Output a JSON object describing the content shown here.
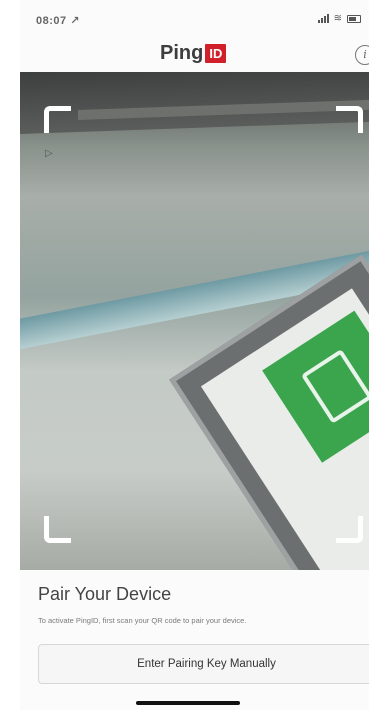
{
  "status_bar": {
    "time": "08:07",
    "time_suffix": "↗"
  },
  "header": {
    "logo_text": "Ping",
    "logo_badge": "ID",
    "info_glyph": "i"
  },
  "camera": {
    "cursor_glyph": "▷"
  },
  "pairing": {
    "title": "Pair Your Device",
    "description": "To activate PingID, first scan your QR code to pair your device.",
    "manual_button_label": "Enter Pairing Key Manually"
  },
  "colors": {
    "brand_red": "#d0202a",
    "scanner_green": "#3aa54d"
  },
  "icons": [
    "info-icon",
    "signal-icon",
    "wifi-icon",
    "battery-icon",
    "location-arrow-icon"
  ]
}
